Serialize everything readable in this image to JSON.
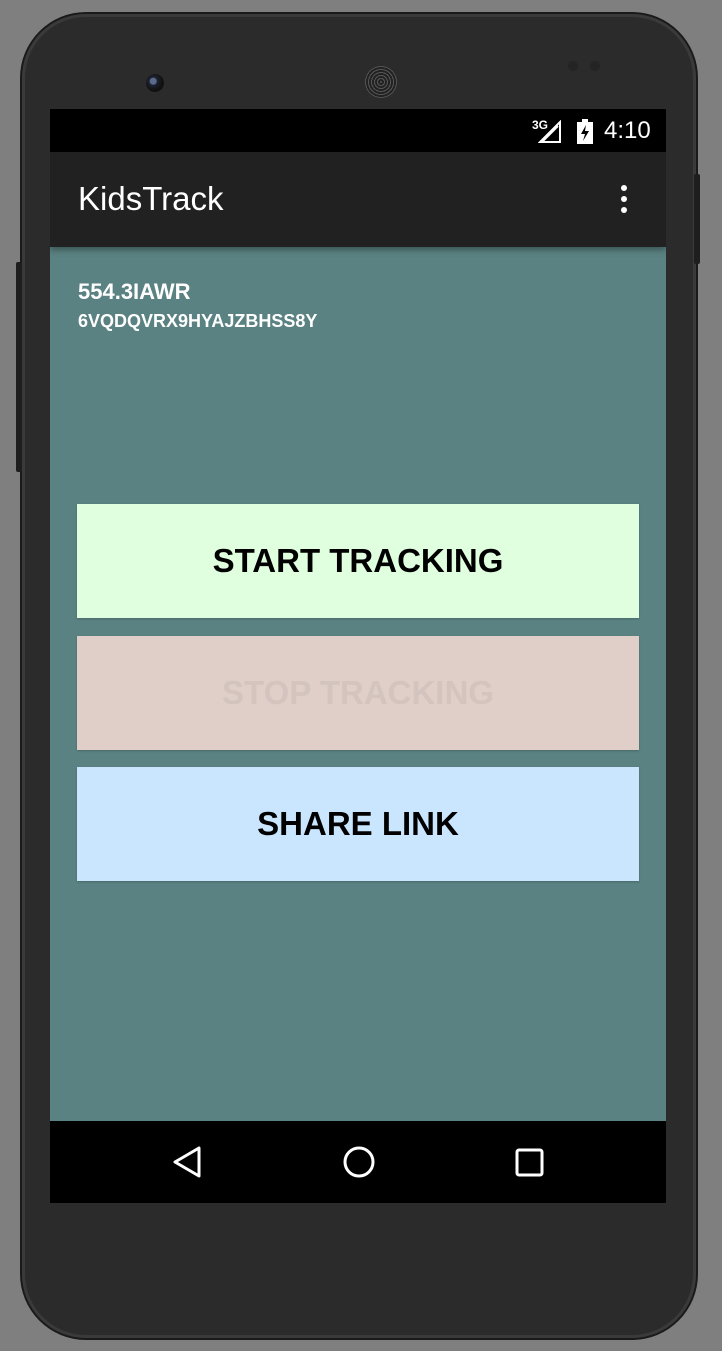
{
  "status_bar": {
    "network": "3G",
    "time": "4:10"
  },
  "app_bar": {
    "title": "KidsTrack",
    "menu_icon": "more-vert-icon"
  },
  "main": {
    "code_line_1": "554.3IAWR",
    "code_line_2": "6VQDQVRX9HYAJZBHSS8Y",
    "buttons": {
      "start": "START TRACKING",
      "stop": "STOP TRACKING",
      "share": "SHARE LINK"
    }
  },
  "nav_bar": {
    "back_icon": "back-triangle-icon",
    "home_icon": "home-circle-icon",
    "recents_icon": "recents-square-icon"
  },
  "colors": {
    "content_bg": "#5a8282",
    "start_bg": "#e0ffdf",
    "stop_bg": "#e0cec8",
    "share_bg": "#c9e6fe",
    "app_bar_bg": "#212121"
  }
}
